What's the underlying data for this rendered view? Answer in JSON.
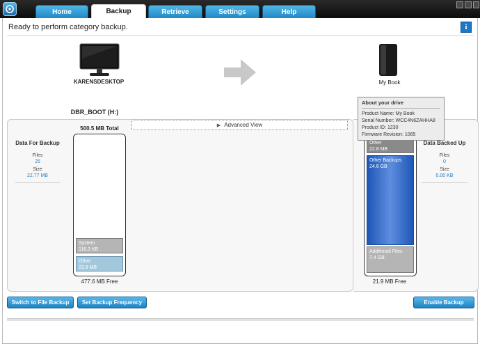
{
  "tabs": [
    {
      "label": "Home"
    },
    {
      "label": "Backup"
    },
    {
      "label": "Retrieve"
    },
    {
      "label": "Settings"
    },
    {
      "label": "Help"
    }
  ],
  "status": "Ready to perform category backup.",
  "info_glyph": "i",
  "computer": {
    "name": "KARENSDESKTOP",
    "volume": "DBR_BOOT (H:)"
  },
  "drive": {
    "name": "My Book"
  },
  "advanced_view": "Advanced View",
  "left_stats": {
    "title": "Data For Backup",
    "files_label": "Files",
    "files_value": "25",
    "size_label": "Size",
    "size_value": "22.77 MB"
  },
  "right_stats": {
    "title": "Data Backed Up",
    "files_label": "Files",
    "files_value": "0",
    "size_label": "Size",
    "size_value": "0.00 KB"
  },
  "source_column": {
    "total": "500.5 MB Total",
    "free": "477.6 MB Free",
    "segments": [
      {
        "label": "System",
        "value": "116.3 KB"
      },
      {
        "label": "Other",
        "value": "22.8 MB"
      }
    ]
  },
  "dest_column": {
    "free": "21.9 MB Free",
    "segments": [
      {
        "label": "Other",
        "value": "22.8 MB"
      },
      {
        "label": "Other Backups",
        "value": "24.6 GB"
      },
      {
        "label": "Additional Files",
        "value": "7.4 GB"
      }
    ]
  },
  "tooltip": {
    "title": "About your drive",
    "product_name": "Product Name: My Book",
    "serial": "Serial Number: WCC4N6ZAHHA8",
    "product_id": "Product ID: 1230",
    "firmware": "Firmware Revision: 1065"
  },
  "buttons": {
    "switch": "Switch to File Backup",
    "frequency": "Set Backup Frequency",
    "enable": "Enable Backup"
  },
  "colors": {
    "accent": "#1f86c4",
    "bar_blue": "#1f57b8"
  }
}
